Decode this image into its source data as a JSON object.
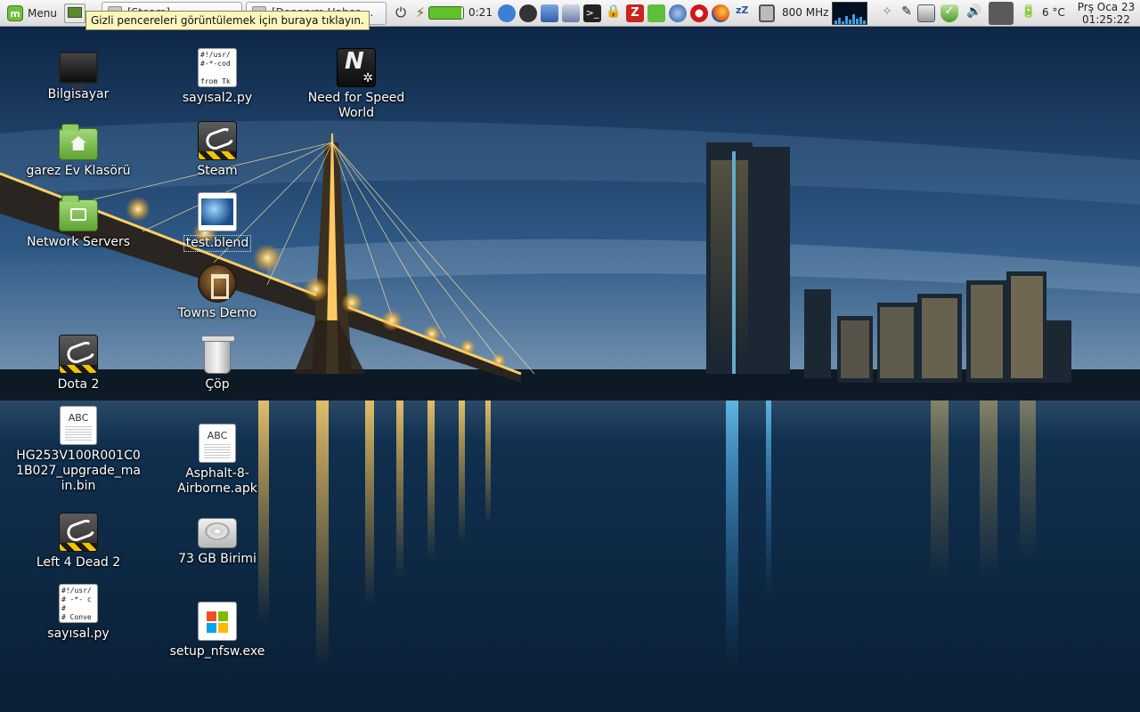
{
  "panel": {
    "menu_label": "Menu",
    "menu_icon": "linux-mint-logo-icon",
    "tooltip": "Gizli pencereleri görüntülemek için buraya tıklayın.",
    "taskbar": [
      {
        "title": "[Steam]",
        "icon": "steam-window-icon"
      },
      {
        "title": "[Donanım Haber ...",
        "icon": "browser-window-icon"
      }
    ],
    "tray": {
      "battery_time": "0:21",
      "battery_level": 0.95,
      "cpu_freq": "800 MHz",
      "temperature": "6 °C",
      "icons": [
        "power-icon",
        "usb-plug-icon",
        "chrome-icon",
        "unknown-app-icon",
        "app-icon",
        "app-icon",
        "terminal-icon",
        "lock-icon",
        "filezilla-icon",
        "app-icon",
        "network-globe-icon",
        "opera-icon",
        "firefox-icon",
        "sleep-icon",
        "cpu-monitor-icon",
        "system-monitor-icon",
        "stars-icon",
        "pen-icon",
        "monitor-settings-icon",
        "security-shield-icon",
        "volume-icon",
        "network-signal-icon",
        "power-status-icon"
      ]
    },
    "clock": {
      "date": "Prş Oca 23",
      "time": "01:25:22"
    }
  },
  "desktop": {
    "icons": [
      {
        "label": "Bilgisayar",
        "type": "computer-icon"
      },
      {
        "label": "garez Ev Klasörü",
        "type": "home-folder-icon"
      },
      {
        "label": "Network Servers",
        "type": "network-folder-icon"
      },
      {
        "label": "Dota 2",
        "type": "steam-game-icon"
      },
      {
        "label": "HG253V100R001C01B027_upgrade_main.bin",
        "type": "document-icon"
      },
      {
        "label": "Left 4 Dead 2",
        "type": "steam-game-icon"
      },
      {
        "label": "sayısal.py",
        "type": "python-script-icon",
        "preview": "#!/usr/\n# -*- c\n#\n# Conve"
      },
      {
        "label": "sayısal2.py",
        "type": "python-script-icon",
        "preview": "#!/usr/\n#-*-cod\n\nfrom Tk"
      },
      {
        "label": "Steam",
        "type": "steam-icon"
      },
      {
        "label": "test.blend",
        "type": "blender-file-icon"
      },
      {
        "label": "Towns Demo",
        "type": "towns-game-icon"
      },
      {
        "label": "Çöp",
        "type": "trash-icon"
      },
      {
        "label": "Asphalt-8-Airborne.apk",
        "type": "document-icon"
      },
      {
        "label": "73 GB Birimi",
        "type": "hard-disk-icon"
      },
      {
        "label": "setup_nfsw.exe",
        "type": "windows-exe-icon"
      },
      {
        "label": "Need for Speed World",
        "type": "nfs-game-icon"
      }
    ]
  },
  "colors": {
    "panel_bg": "#e6e6e6",
    "tooltip_bg": "#fcf6bc",
    "sky_top": "#0a1d3a",
    "water": "#0e2a47",
    "bridge_light": "#ffcc55"
  }
}
